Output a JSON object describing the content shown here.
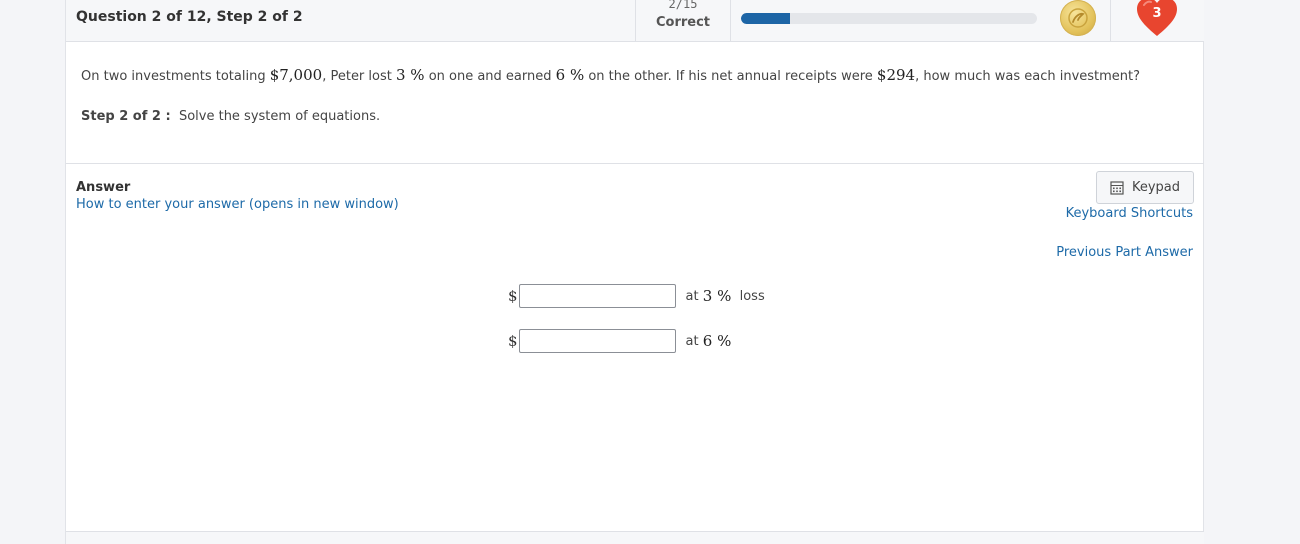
{
  "header": {
    "question_title": "Question 2 of 12, Step 2 of 2",
    "score": "2/15",
    "score_label": "Correct",
    "progress": 0.1667,
    "lives": "3",
    "accent": "#1d65a6",
    "heart_color": "#e8452f"
  },
  "question": {
    "parts": [
      "On two investments totaling ",
      "$7,000",
      ", Peter lost ",
      "3 %",
      " on one and earned ",
      "6 %",
      " on the other. If his net annual receipts were ",
      "$294",
      ", how much was each investment?"
    ]
  },
  "step": {
    "label": "Step 2 of 2 :",
    "text": "Solve the system of equations."
  },
  "answer": {
    "label": "Answer",
    "howto_link": "How to enter your answer (opens in new window)",
    "keypad_label": "Keypad",
    "keyboard_shortcuts": "Keyboard Shortcuts",
    "previous_part": "Previous Part Answer",
    "rows": [
      {
        "currency": "$",
        "value": "",
        "at": "at",
        "rate": "3 %",
        "suffix": "loss"
      },
      {
        "currency": "$",
        "value": "",
        "at": "at",
        "rate": "6 %",
        "suffix": ""
      }
    ]
  }
}
